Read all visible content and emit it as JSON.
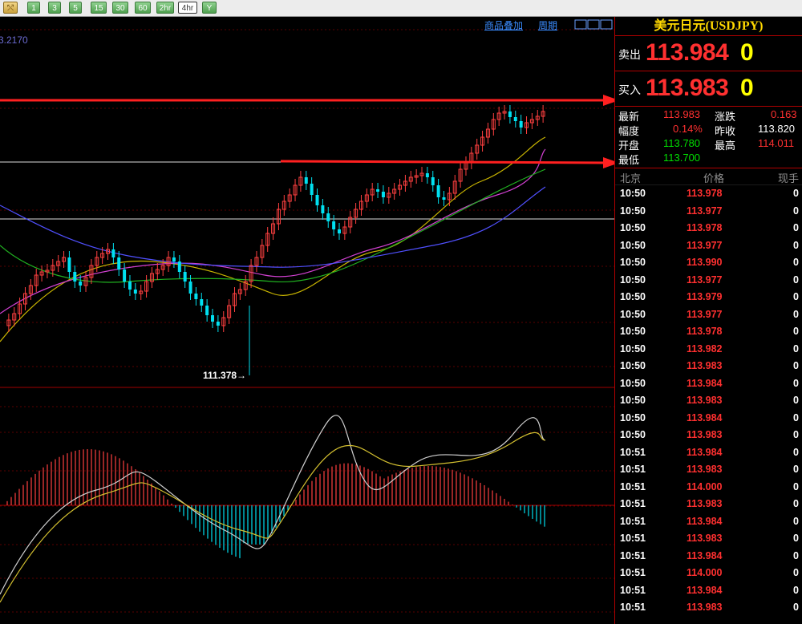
{
  "toolbar": {
    "buttons": [
      "⤲",
      "1",
      "3",
      "5",
      "15",
      "30",
      "60",
      "2hr",
      "4hr",
      "Y"
    ]
  },
  "chart_header": {
    "overlay_link": "商品叠加",
    "period_link": "周期",
    "top_left_value": "3.2170",
    "low_annotation": "111.378"
  },
  "quote": {
    "title": "美元日元(USDJPY)",
    "sell_label": "卖出",
    "sell_price": "113.984",
    "sell_volume": "0",
    "buy_label": "买入",
    "buy_price": "113.983",
    "buy_volume": "0",
    "stats": {
      "latest_label": "最新",
      "latest": "113.983",
      "change_label": "涨跌",
      "change": "0.163",
      "range_label": "幅度",
      "range": "0.14%",
      "prev_close_label": "昨收",
      "prev_close": "113.820",
      "open_label": "开盘",
      "open": "113.780",
      "high_label": "最高",
      "high": "114.011",
      "low_label": "最低",
      "low": "113.700"
    }
  },
  "ticks": {
    "headers": {
      "time": "北京",
      "price": "价格",
      "volume": "现手"
    },
    "rows": [
      {
        "time": "10:50",
        "price": "113.978",
        "volume": "0"
      },
      {
        "time": "10:50",
        "price": "113.977",
        "volume": "0"
      },
      {
        "time": "10:50",
        "price": "113.978",
        "volume": "0"
      },
      {
        "time": "10:50",
        "price": "113.977",
        "volume": "0"
      },
      {
        "time": "10:50",
        "price": "113.990",
        "volume": "0"
      },
      {
        "time": "10:50",
        "price": "113.977",
        "volume": "0"
      },
      {
        "time": "10:50",
        "price": "113.979",
        "volume": "0"
      },
      {
        "time": "10:50",
        "price": "113.977",
        "volume": "0"
      },
      {
        "time": "10:50",
        "price": "113.978",
        "volume": "0"
      },
      {
        "time": "10:50",
        "price": "113.982",
        "volume": "0"
      },
      {
        "time": "10:50",
        "price": "113.983",
        "volume": "0"
      },
      {
        "time": "10:50",
        "price": "113.984",
        "volume": "0"
      },
      {
        "time": "10:50",
        "price": "113.983",
        "volume": "0"
      },
      {
        "time": "10:50",
        "price": "113.984",
        "volume": "0"
      },
      {
        "time": "10:50",
        "price": "113.983",
        "volume": "0"
      },
      {
        "time": "10:51",
        "price": "113.984",
        "volume": "0"
      },
      {
        "time": "10:51",
        "price": "113.983",
        "volume": "0"
      },
      {
        "time": "10:51",
        "price": "114.000",
        "volume": "0"
      },
      {
        "time": "10:51",
        "price": "113.983",
        "volume": "0"
      },
      {
        "time": "10:51",
        "price": "113.984",
        "volume": "0"
      },
      {
        "time": "10:51",
        "price": "113.983",
        "volume": "0"
      },
      {
        "time": "10:51",
        "price": "113.984",
        "volume": "0"
      },
      {
        "time": "10:51",
        "price": "114.000",
        "volume": "0"
      },
      {
        "time": "10:51",
        "price": "113.984",
        "volume": "0"
      },
      {
        "time": "10:51",
        "price": "113.983",
        "volume": "0"
      }
    ]
  },
  "chart_data": {
    "type": "line",
    "symbol": "USDJPY",
    "y_low_marked": 111.378,
    "price_path_samples": [
      112.0,
      112.4,
      112.6,
      112.9,
      112.8,
      112.7,
      113.0,
      112.6,
      112.3,
      112.5,
      111.6,
      111.4,
      112.0,
      112.6,
      113.0,
      113.3,
      113.6,
      113.1,
      113.2,
      113.4,
      113.2,
      113.6,
      113.5,
      113.9,
      114.0,
      113.98
    ],
    "colors": {
      "bull": "#ff4040",
      "bear": "#00e0f0",
      "ma1": "#c8b400",
      "ma2": "#d040d0",
      "ma3": "#20b020",
      "ma4": "#5050ff",
      "macd_dif": "#d0d0d0",
      "macd_dea": "#d4c030",
      "hline_red": "#ff2020"
    }
  }
}
